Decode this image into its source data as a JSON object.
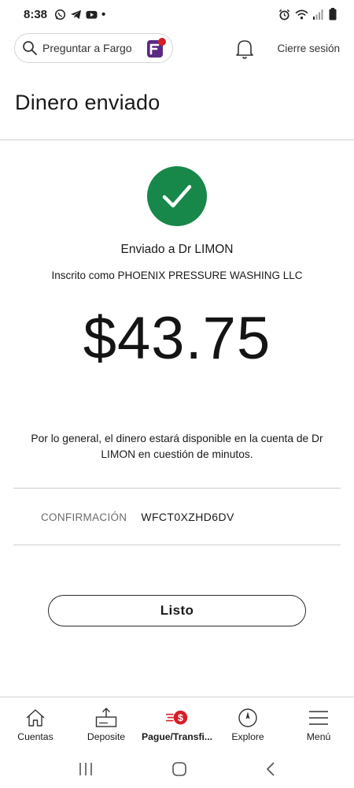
{
  "status_bar": {
    "time": "8:38",
    "dot": "•",
    "left_icons": [
      "whatsapp-icon",
      "telegram-icon",
      "youtube-icon"
    ],
    "right_icons": [
      "alarm-icon",
      "wifi-icon",
      "signal-icon",
      "battery-icon"
    ]
  },
  "header": {
    "search_placeholder": "Preguntar a Fargo",
    "logout_label": "Cierre sesión"
  },
  "page": {
    "title": "Dinero enviado"
  },
  "confirmation": {
    "sent_to": "Enviado a Dr LIMON",
    "enrolled_as": "Inscrito como PHOENIX PRESSURE WASHING LLC",
    "amount": "$43.75",
    "availability_note": "Por lo general, el dinero estará disponible en la cuenta de Dr LIMON en cuestión de minutos.",
    "confirmation_label": "CONFIRMACIÓN",
    "confirmation_code": "WFCT0XZHD6DV",
    "done_label": "Listo"
  },
  "colors": {
    "success_green": "#17874a",
    "brand_red": "#d71e28",
    "fargo_purple": "#5a2a82"
  },
  "bottom_nav": {
    "items": [
      {
        "label": "Cuentas",
        "icon": "house-icon",
        "active": false
      },
      {
        "label": "Deposite",
        "icon": "deposit-icon",
        "active": false
      },
      {
        "label": "Pague/Transfi...",
        "icon": "pay-transfer-icon",
        "active": true
      },
      {
        "label": "Explore",
        "icon": "compass-icon",
        "active": false
      },
      {
        "label": "Menú",
        "icon": "hamburger-menu-icon",
        "active": false
      }
    ]
  }
}
